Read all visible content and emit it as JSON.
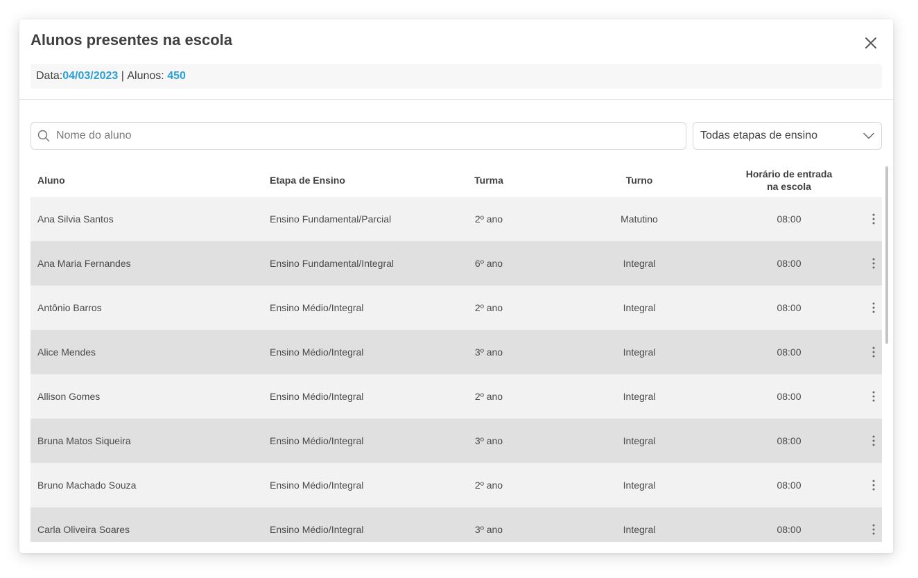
{
  "modal": {
    "title": "Alunos presentes na escola",
    "close_icon": "close-icon"
  },
  "info": {
    "date_label": "Data: ",
    "date_value": "04/03/2023",
    "separator": " | ",
    "students_label": "Alunos: ",
    "students_value": "450"
  },
  "filters": {
    "search_placeholder": "Nome do aluno",
    "search_value": "",
    "stage_select_value": "Todas etapas de ensino"
  },
  "table": {
    "headers": {
      "aluno": "Aluno",
      "etapa": "Etapa de Ensino",
      "turma": "Turma",
      "turno": "Turno",
      "horario_line1": "Horário de entrada",
      "horario_line2": "na escola"
    },
    "rows": [
      {
        "aluno": "Ana Silvia Santos",
        "etapa": "Ensino Fundamental/Parcial",
        "turma": "2º ano",
        "turno": "Matutino",
        "horario": "08:00"
      },
      {
        "aluno": "Ana Maria Fernandes",
        "etapa": "Ensino Fundamental/Integral",
        "turma": "6º ano",
        "turno": "Integral",
        "horario": "08:00"
      },
      {
        "aluno": "Antônio Barros",
        "etapa": "Ensino Médio/Integral",
        "turma": "2º ano",
        "turno": "Integral",
        "horario": "08:00"
      },
      {
        "aluno": "Alice Mendes",
        "etapa": "Ensino Médio/Integral",
        "turma": "3º ano",
        "turno": "Integral",
        "horario": "08:00"
      },
      {
        "aluno": "Allison Gomes",
        "etapa": "Ensino Médio/Integral",
        "turma": "2º ano",
        "turno": "Integral",
        "horario": "08:00"
      },
      {
        "aluno": "Bruna Matos Siqueira",
        "etapa": "Ensino Médio/Integral",
        "turma": "3º ano",
        "turno": "Integral",
        "horario": "08:00"
      },
      {
        "aluno": "Bruno Machado Souza",
        "etapa": "Ensino Médio/Integral",
        "turma": "2º ano",
        "turno": "Integral",
        "horario": "08:00"
      },
      {
        "aluno": "Carla Oliveira Soares",
        "etapa": "Ensino Médio/Integral",
        "turma": "3º ano",
        "turno": "Integral",
        "horario": "08:00"
      }
    ]
  },
  "colors": {
    "accent": "#2b9fd6",
    "row_odd": "#f2f2f2",
    "row_even": "#e0e0e0"
  },
  "icons": {
    "search": "search-icon",
    "select": "chevron-down-icon",
    "row_menu": "kebab-menu-icon"
  }
}
